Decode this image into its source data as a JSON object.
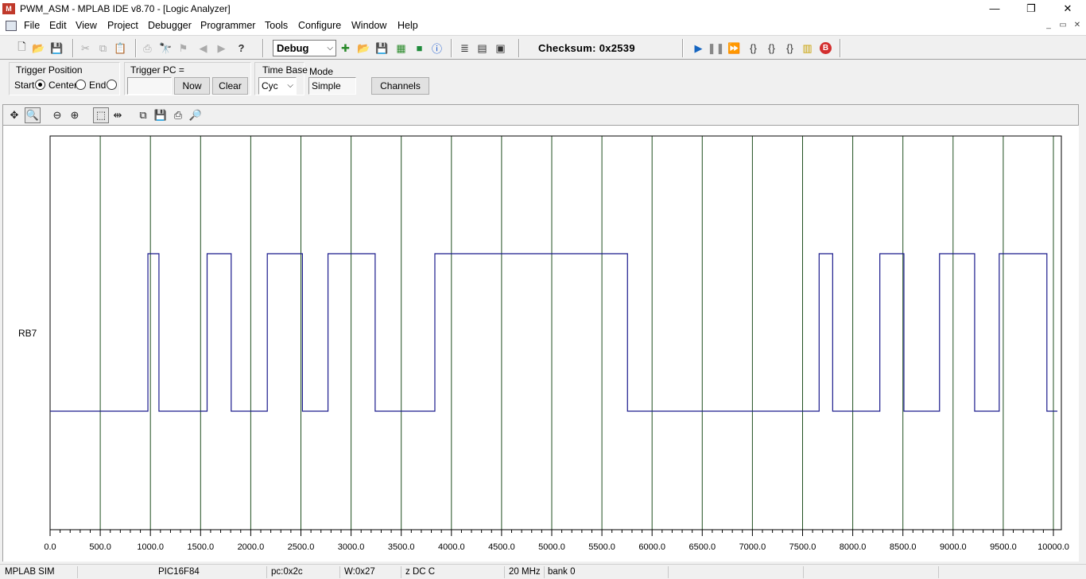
{
  "window": {
    "title": "PWM_ASM - MPLAB IDE v8.70 - [Logic Analyzer]",
    "app_icon": "mplab-icon",
    "controls": {
      "minimize": "—",
      "restore": "❐",
      "close": "✕"
    }
  },
  "menu": {
    "items": [
      "File",
      "Edit",
      "View",
      "Project",
      "Debugger",
      "Programmer",
      "Tools",
      "Configure",
      "Window",
      "Help"
    ],
    "mdi": {
      "minimize": "_",
      "restore": "▭",
      "close": "✕"
    }
  },
  "toolbar": {
    "build_config": "Debug",
    "checksum": "Checksum:  0x2539"
  },
  "logic_analyzer": {
    "trigger_position": {
      "label": "Trigger Position",
      "options": [
        "Start",
        "Center",
        "End"
      ],
      "selected": "Start"
    },
    "trigger_pc": {
      "label": "Trigger PC =",
      "value": "",
      "now_label": "Now",
      "clear_label": "Clear"
    },
    "time_base": {
      "label": "Time Base",
      "value": "Cyc"
    },
    "mode": {
      "label": "Mode",
      "value": "Simple"
    },
    "channels_label": "Channels"
  },
  "chart_data": {
    "type": "line",
    "series": [
      {
        "name": "RB7",
        "transitions": [
          [
            0,
            0
          ],
          [
            975,
            1
          ],
          [
            1085,
            0
          ],
          [
            1565,
            1
          ],
          [
            1805,
            0
          ],
          [
            2165,
            1
          ],
          [
            2515,
            0
          ],
          [
            2770,
            1
          ],
          [
            3240,
            0
          ],
          [
            3835,
            1
          ],
          [
            5755,
            0
          ],
          [
            7665,
            1
          ],
          [
            7800,
            0
          ],
          [
            8270,
            1
          ],
          [
            8510,
            0
          ],
          [
            8865,
            1
          ],
          [
            9215,
            0
          ],
          [
            9460,
            1
          ],
          [
            9935,
            0
          ],
          [
            10040,
            0
          ]
        ]
      }
    ],
    "xlim": [
      0,
      10000
    ],
    "ticks": [
      "0.0",
      "500.0",
      "1000.0",
      "1500.0",
      "2000.0",
      "2500.0",
      "3000.0",
      "3500.0",
      "4000.0",
      "4500.0",
      "5000.0",
      "5500.0",
      "6000.0",
      "6500.0",
      "7000.0",
      "7500.0",
      "8000.0",
      "8500.0",
      "9000.0",
      "9500.0",
      "10000.0"
    ],
    "grid": true,
    "colors": {
      "signal": "#1a1a8c",
      "grid": "#1f4f1f"
    }
  },
  "status": {
    "debugger": "MPLAB SIM",
    "device": "PIC16F84",
    "pc": "pc:0x2c",
    "w": "W:0x27",
    "flags": "z DC C",
    "freq": "20 MHz",
    "bank": "bank 0"
  }
}
